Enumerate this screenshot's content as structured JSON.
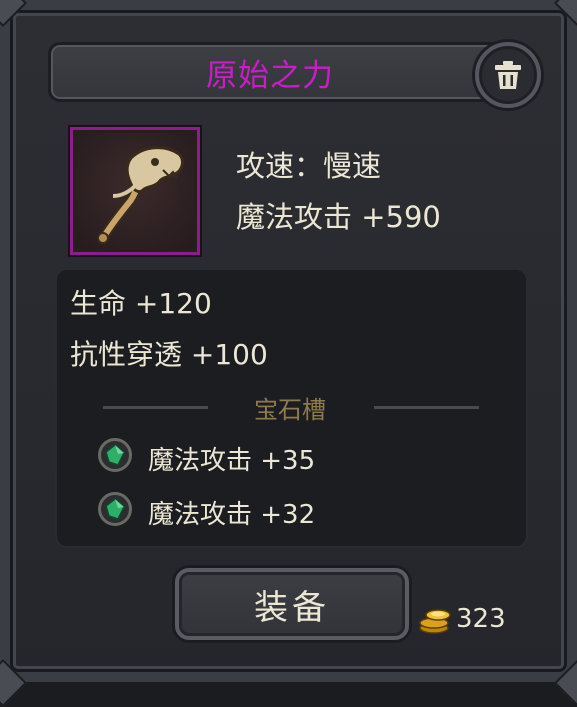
{
  "item": {
    "name": "原始之力",
    "name_color": "#c81ec8",
    "rarity_color": "#8e1c8e",
    "icon": "bone-axe-icon"
  },
  "main_stats": {
    "attack_speed": "攻速：慢速",
    "magic_attack": "魔法攻击 +590"
  },
  "attributes": [
    "生命 +120",
    "抗性穿透 +100"
  ],
  "gem_slots": {
    "header": "宝石槽",
    "gems": [
      {
        "text": "魔法攻击 +35",
        "icon": "green-gem-icon"
      },
      {
        "text": "魔法攻击 +32",
        "icon": "green-gem-icon"
      }
    ]
  },
  "actions": {
    "equip_label": "装备",
    "delete_icon": "trash-icon"
  },
  "currency": {
    "gold": "323",
    "icon": "gold-coins-icon"
  }
}
